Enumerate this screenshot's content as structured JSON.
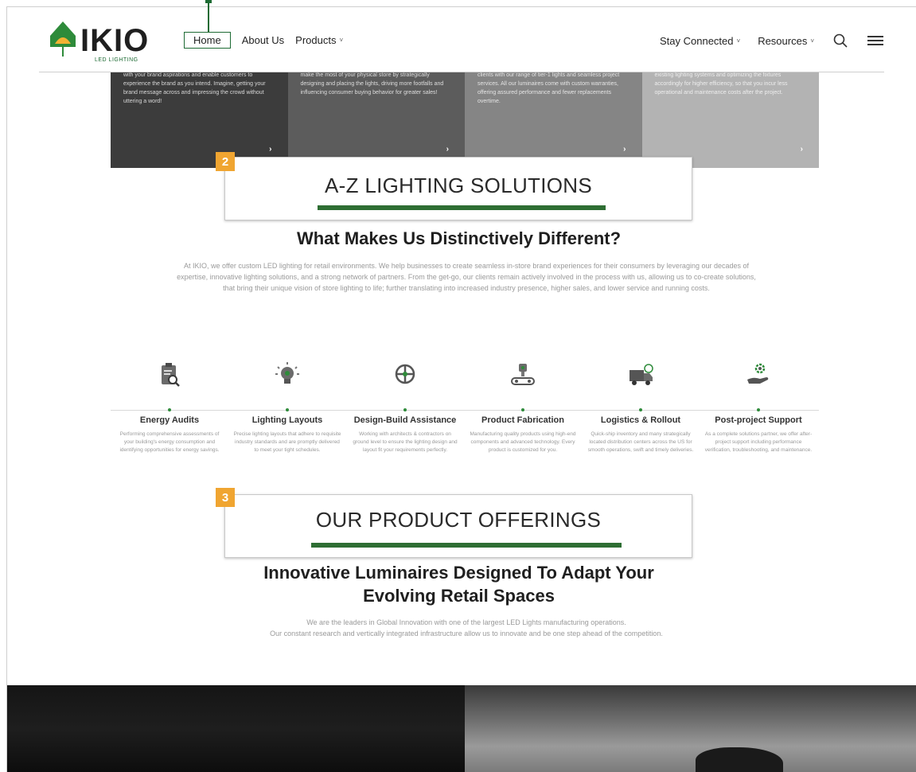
{
  "header": {
    "logo": {
      "word": "IKIO",
      "sub": "LED LIGHTING"
    },
    "nav_left": [
      {
        "label": "Home",
        "active": true,
        "has_caret": false
      },
      {
        "label": "About Us",
        "active": false,
        "has_caret": false
      },
      {
        "label": "Products",
        "active": false,
        "has_caret": true
      }
    ],
    "nav_right": [
      {
        "label": "Stay Connected",
        "has_caret": true
      },
      {
        "label": "Resources",
        "has_caret": true
      }
    ],
    "icons": [
      "search-icon",
      "menu-icon"
    ]
  },
  "cards": [
    {
      "text": "with your brand aspirations and enable customers to experience the brand as you intend. Imagine, getting your brand message across and impressing the crowd without uttering a word!",
      "color": "#3c3c3c"
    },
    {
      "text": "make the most of your physical store by strategically designing and placing the lights, driving more footfalls and influencing consumer buying behavior for greater sales!",
      "color": "#5c5c5c"
    },
    {
      "text": "clients with our range of tier-1 lights and seamless project services. All our luminaires come with custom warranties, offering assured performance and fewer replacements overtime.",
      "color": "#858585"
    },
    {
      "text": "existing lighting systems and optimizing the fixtures accordingly for higher efficiency, so that you incur less operational and maintenance costs after the project.",
      "color": "#b3b3b3"
    }
  ],
  "section2": {
    "badge": "2",
    "label": "A-Z LIGHTING SOLUTIONS",
    "heading": "What Makes Us Distinctively Different?",
    "paragraph": "At IKIO, we offer custom LED lighting for retail environments. We help businesses to create seamless in-store brand experiences for their consumers by leveraging our decades of expertise, innovative lighting solutions, and a strong network of partners. From the get-go, our clients remain actively involved in the process with us, allowing us to co-create solutions, that bring their unique vision of store lighting to life; further translating into increased industry presence, higher sales, and lower service and running costs."
  },
  "services": [
    {
      "icon": "clipboard-search-icon",
      "title": "Energy Audits",
      "desc": "Performing comprehensive assessments of your building's energy consumption and identifying opportunities for energy savings."
    },
    {
      "icon": "lightbulb-icon",
      "title": "Lighting Layouts",
      "desc": "Precise lighting layouts that adhere to requisite industry standards and are promptly delivered to meet your tight schedules."
    },
    {
      "icon": "design-wheel-icon",
      "title": "Design-Build Assistance",
      "desc": "Working with architects & contractors on ground level to ensure the lighting design and layout fit your requirements perfectly."
    },
    {
      "icon": "conveyor-robot-icon",
      "title": "Product Fabrication",
      "desc": "Manufacturing quality products using high-end components and advanced technology. Every product is customized for you."
    },
    {
      "icon": "delivery-truck-icon",
      "title": "Logistics & Rollout",
      "desc": "Quick-ship inventory and many strategically located distribution centers across the US for smooth operations, swift and timely deliveries."
    },
    {
      "icon": "hand-gear-icon",
      "title": "Post-project Support",
      "desc": "As a complete solutions partner, we offer after-project support including performance verification, troubleshooting, and maintenance."
    }
  ],
  "section3": {
    "badge": "3",
    "label": "OUR PRODUCT OFFERINGS",
    "heading_line1": "Innovative Luminaires Designed To Adapt Your",
    "heading_line2": "Evolving Retail Spaces",
    "paragraph_line1": "We are the leaders in Global Innovation with one of the largest LED Lights manufacturing operations.",
    "paragraph_line2": "Our constant research and vertically integrated infrastructure allow us to innovate and be one step ahead of the competition."
  },
  "colors": {
    "brand_green": "#1e6b34",
    "badge_orange": "#f0a531",
    "bar_green": "#2e6e33"
  }
}
